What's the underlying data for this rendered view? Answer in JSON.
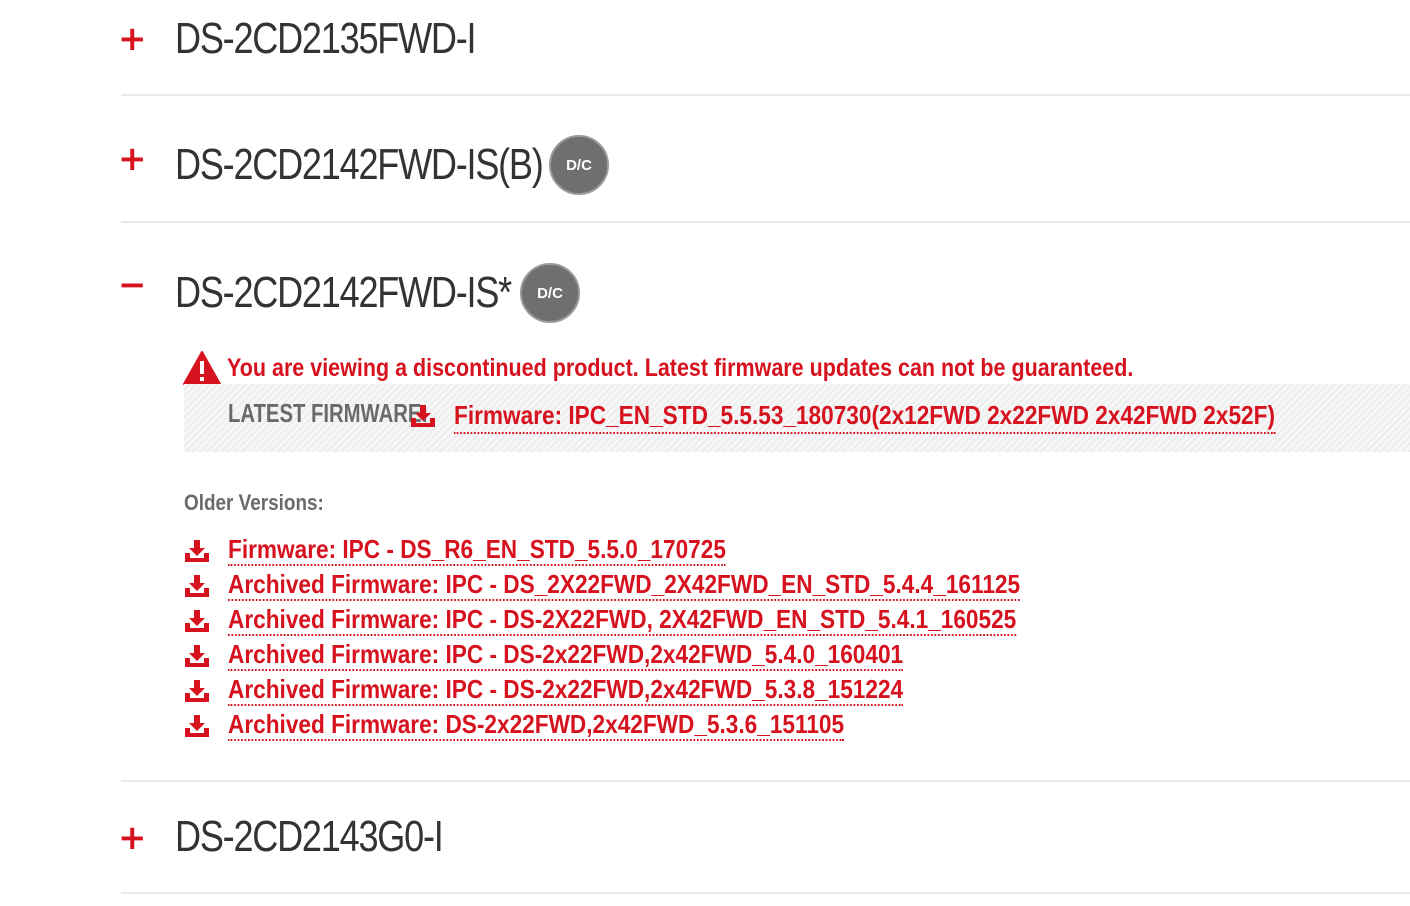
{
  "products": [
    {
      "toggle": "+",
      "name": "DS-2CD2135FWD-I",
      "badge": null
    },
    {
      "toggle": "+",
      "name": "DS-2CD2142FWD-IS(B)",
      "badge": "D/C"
    },
    {
      "toggle": "−",
      "name": "DS-2CD2142FWD-IS*",
      "badge": "D/C"
    },
    {
      "toggle": "+",
      "name": "DS-2CD2143G0-I",
      "badge": null
    }
  ],
  "expanded": {
    "warning_icon": "warning-triangle-icon",
    "warning_text": "You are viewing a discontinued product. Latest firmware updates can not be guaranteed.",
    "latest_label": "LATEST FIRMWARE:",
    "download_icon": "download-icon",
    "latest_link": "Firmware: IPC_EN_STD_5.5.53_180730(2x12FWD 2x22FWD 2x42FWD 2x52F)",
    "older_label": "Older Versions:",
    "older_links": [
      "Firmware: IPC - DS_R6_EN_STD_5.5.0_170725",
      "Archived Firmware: IPC - DS_2X22FWD_2X42FWD_EN_STD_5.4.4_161125",
      "Archived Firmware: IPC - DS-2X22FWD, 2X42FWD_EN_STD_5.4.1_160525",
      "Archived Firmware: IPC - DS-2x22FWD,2x42FWD_5.4.0_160401",
      "Archived Firmware: IPC - DS-2x22FWD,2x42FWD_5.3.8_151224",
      "Archived Firmware: DS-2x22FWD,2x42FWD_5.3.6_151105"
    ]
  },
  "colors": {
    "accent": "#d7121f",
    "badge": "#6f6f6f",
    "title": "#333333",
    "muted": "#6a6a6a"
  }
}
